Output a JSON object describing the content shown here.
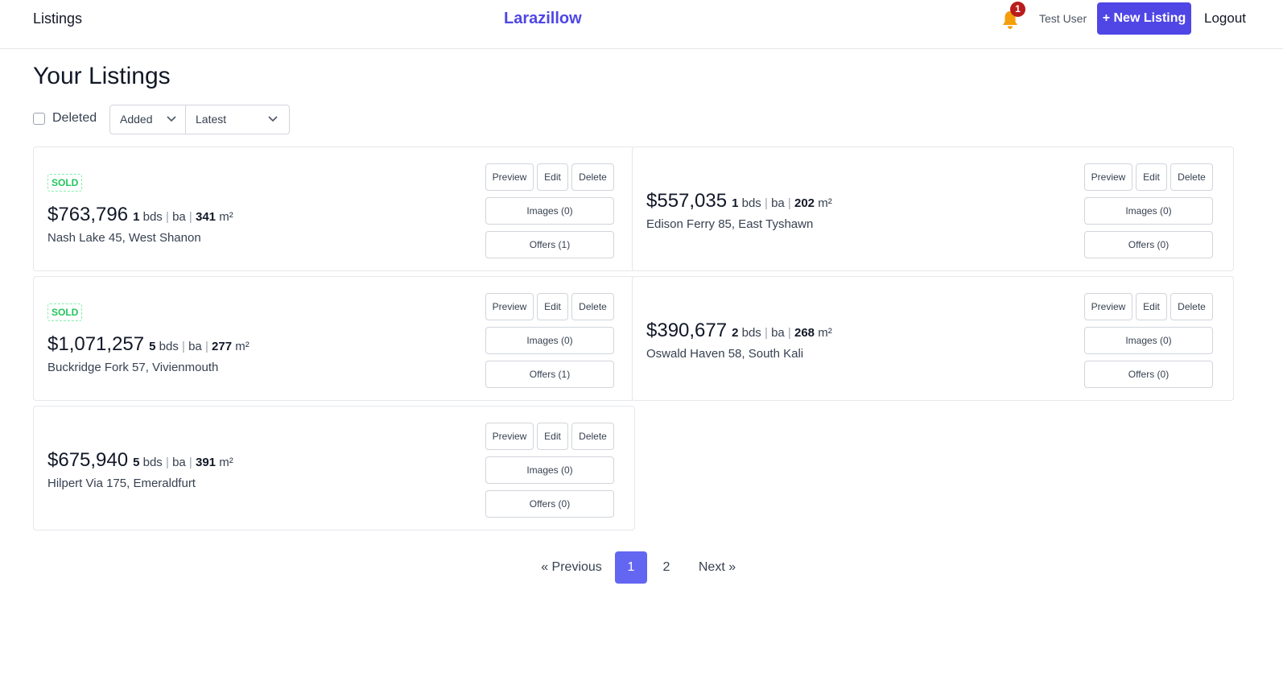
{
  "header": {
    "nav_listings": "Listings",
    "brand": "Larazillow",
    "notification_count": "1",
    "user_name": "Test User",
    "new_listing": "+ New Listing",
    "logout": "Logout"
  },
  "page": {
    "title": "Your Listings",
    "deleted_label": "Deleted",
    "sort_by": "Added",
    "sort_order": "Latest"
  },
  "listings": [
    {
      "sold": "SOLD",
      "price": "$763,796",
      "beds": "1",
      "beds_unit": "bds",
      "baths_unit": "ba",
      "area": "341",
      "area_unit": "m²",
      "address": "Nash Lake 45, West Shanon",
      "preview": "Preview",
      "edit": "Edit",
      "delete": "Delete",
      "images": "Images (0)",
      "offers": "Offers (1)"
    },
    {
      "sold": "",
      "price": "$557,035",
      "beds": "1",
      "beds_unit": "bds",
      "baths_unit": "ba",
      "area": "202",
      "area_unit": "m²",
      "address": "Edison Ferry 85, East Tyshawn",
      "preview": "Preview",
      "edit": "Edit",
      "delete": "Delete",
      "images": "Images (0)",
      "offers": "Offers (0)"
    },
    {
      "sold": "SOLD",
      "price": "$1,071,257",
      "beds": "5",
      "beds_unit": "bds",
      "baths_unit": "ba",
      "area": "277",
      "area_unit": "m²",
      "address": "Buckridge Fork 57, Vivienmouth",
      "preview": "Preview",
      "edit": "Edit",
      "delete": "Delete",
      "images": "Images (0)",
      "offers": "Offers (1)"
    },
    {
      "sold": "",
      "price": "$390,677",
      "beds": "2",
      "beds_unit": "bds",
      "baths_unit": "ba",
      "area": "268",
      "area_unit": "m²",
      "address": "Oswald Haven 58, South Kali",
      "preview": "Preview",
      "edit": "Edit",
      "delete": "Delete",
      "images": "Images (0)",
      "offers": "Offers (0)"
    },
    {
      "sold": "",
      "price": "$675,940",
      "beds": "5",
      "beds_unit": "bds",
      "baths_unit": "ba",
      "area": "391",
      "area_unit": "m²",
      "address": "Hilpert Via 175, Emeraldfurt",
      "preview": "Preview",
      "edit": "Edit",
      "delete": "Delete",
      "images": "Images (0)",
      "offers": "Offers (0)"
    }
  ],
  "pagination": {
    "previous": "« Previous",
    "pages": [
      "1",
      "2"
    ],
    "current": "1",
    "next": "Next »"
  },
  "colors": {
    "brand": "#4f46e5",
    "active_page": "#6366f1",
    "sold": "#22c55e",
    "badge": "#b91c1c",
    "bell": "#f59e0b"
  },
  "icons": {
    "bell": "bell-icon",
    "chevron": "chevron-down-icon"
  }
}
